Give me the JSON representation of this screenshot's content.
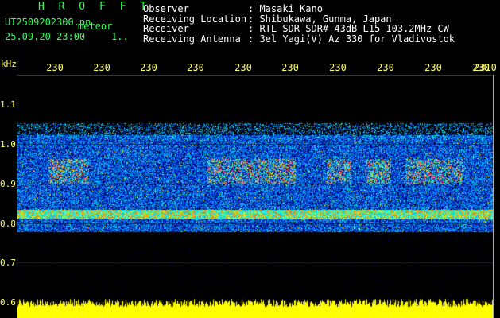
{
  "header": {
    "app_name": "H R O F F T",
    "file_name": "UT2509202300.pn",
    "meteor_label": "meteor",
    "date_time": "25.09.20 23:00",
    "count": "1.."
  },
  "info": [
    {
      "label": "Observer",
      "value": ": Masaki Kano"
    },
    {
      "label": "Receiving Location",
      "value": ": Shibukawa, Gunma, Japan"
    },
    {
      "label": "Receiver",
      "value": ": RTL-SDR SDR# 43dB L15 103.2MHz CW"
    },
    {
      "label": "Receiving Antenna",
      "value": ": 3el Yagi(V) Az 330 for Vladivostok"
    }
  ],
  "axis": {
    "unit": "kHz",
    "time_ticks": [
      "230",
      "230",
      "230",
      "230",
      "230",
      "230",
      "230",
      "230",
      "230",
      "230",
      "2310"
    ],
    "freq_labels": [
      "1.1",
      "1.0",
      "0.9",
      "0.8",
      "0.7",
      "0.6"
    ]
  },
  "colors": {
    "background": "#000000",
    "title_green": "#33ff55",
    "tick_yellow": "#ffff66",
    "power_bar": "#ffff00"
  }
}
